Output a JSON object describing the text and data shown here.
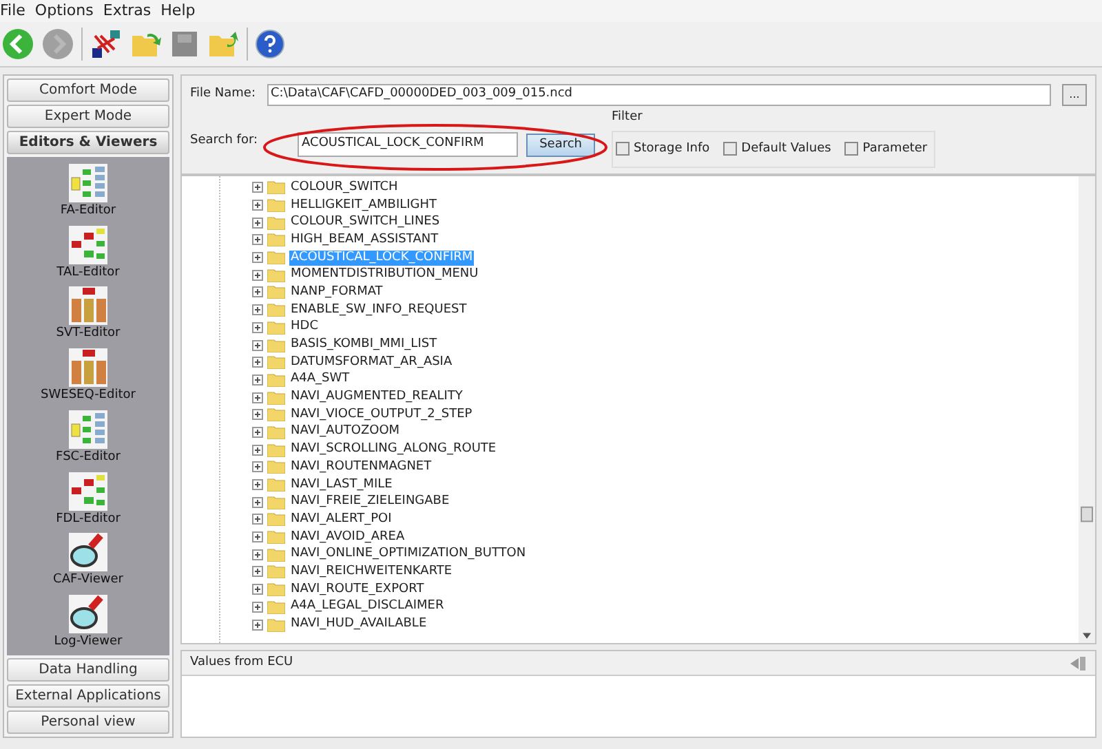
{
  "menu": [
    "File",
    "Options",
    "Extras",
    "Help"
  ],
  "toolbar": [
    {
      "kind": "back",
      "disabled": false
    },
    {
      "kind": "forward",
      "disabled": true
    },
    {
      "kind": "network",
      "disabled": false
    },
    {
      "kind": "folder-open",
      "disabled": false
    },
    {
      "kind": "save",
      "disabled": true
    },
    {
      "kind": "folder",
      "disabled": false
    },
    {
      "kind": "help",
      "disabled": false
    }
  ],
  "sidebar": {
    "sections_top": [
      {
        "label": "Comfort Mode",
        "selected": false
      },
      {
        "label": "Expert Mode",
        "selected": false
      },
      {
        "label": "Editors & Viewers",
        "selected": true
      }
    ],
    "tools": [
      {
        "label": "FA-Editor",
        "kind": "tree"
      },
      {
        "label": "TAL-Editor",
        "kind": "flow"
      },
      {
        "label": "SVT-Editor",
        "kind": "stack"
      },
      {
        "label": "SWESEQ-Editor",
        "kind": "stack"
      },
      {
        "label": "FSC-Editor",
        "kind": "tree"
      },
      {
        "label": "FDL-Editor",
        "kind": "flow"
      },
      {
        "label": "CAF-Viewer",
        "kind": "viewer"
      },
      {
        "label": "Log-Viewer",
        "kind": "viewer"
      }
    ],
    "sections_bottom": [
      {
        "label": "Data Handling",
        "selected": false
      },
      {
        "label": "External Applications",
        "selected": false
      },
      {
        "label": "Personal view",
        "selected": false
      }
    ]
  },
  "file_name": {
    "label": "File Name:",
    "value": "C:\\Data\\CAF\\CAFD_00000DED_003_009_015.ncd",
    "browse": "..."
  },
  "search": {
    "label": "Search for:",
    "value": "ACOUSTICAL_LOCK_CONFIRM",
    "button": "Search"
  },
  "filter": {
    "title": "Filter",
    "options": [
      {
        "label": "Storage Info",
        "checked": false
      },
      {
        "label": "Default Values",
        "checked": false
      },
      {
        "label": "Parameter",
        "checked": false
      }
    ]
  },
  "tree": [
    {
      "label": "COLOUR_SWITCH",
      "selected": false
    },
    {
      "label": "HELLIGKEIT_AMBILIGHT",
      "selected": false
    },
    {
      "label": "COLOUR_SWITCH_LINES",
      "selected": false
    },
    {
      "label": "HIGH_BEAM_ASSISTANT",
      "selected": false
    },
    {
      "label": "ACOUSTICAL_LOCK_CONFIRM",
      "selected": true
    },
    {
      "label": "MOMENTDISTRIBUTION_MENU",
      "selected": false
    },
    {
      "label": "NANP_FORMAT",
      "selected": false
    },
    {
      "label": "ENABLE_SW_INFO_REQUEST",
      "selected": false
    },
    {
      "label": "HDC",
      "selected": false
    },
    {
      "label": "BASIS_KOMBI_MMI_LIST",
      "selected": false
    },
    {
      "label": "DATUMSFORMAT_AR_ASIA",
      "selected": false
    },
    {
      "label": "A4A_SWT",
      "selected": false
    },
    {
      "label": "NAVI_AUGMENTED_REALITY",
      "selected": false
    },
    {
      "label": "NAVI_VIOCE_OUTPUT_2_STEP",
      "selected": false
    },
    {
      "label": "NAVI_AUTOZOOM",
      "selected": false
    },
    {
      "label": "NAVI_SCROLLING_ALONG_ROUTE",
      "selected": false
    },
    {
      "label": "NAVI_ROUTENMAGNET",
      "selected": false
    },
    {
      "label": "NAVI_LAST_MILE",
      "selected": false
    },
    {
      "label": "NAVI_FREIE_ZIELEINGABE",
      "selected": false
    },
    {
      "label": "NAVI_ALERT_POI",
      "selected": false
    },
    {
      "label": "NAVI_AVOID_AREA",
      "selected": false
    },
    {
      "label": "NAVI_ONLINE_OPTIMIZATION_BUTTON",
      "selected": false
    },
    {
      "label": "NAVI_REICHWEITENKARTE",
      "selected": false
    },
    {
      "label": "NAVI_ROUTE_EXPORT",
      "selected": false
    },
    {
      "label": "A4A_LEGAL_DISCLAIMER",
      "selected": false
    },
    {
      "label": "NAVI_HUD_AVAILABLE",
      "selected": false
    }
  ],
  "values_panel": {
    "title": "Values from ECU"
  }
}
